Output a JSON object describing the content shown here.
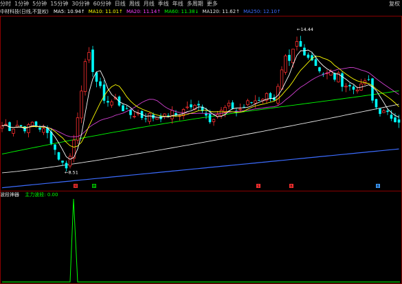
{
  "toolbar": {
    "items": [
      "分时",
      "1分钟",
      "5分钟",
      "15分钟",
      "30分钟",
      "60分钟",
      "日线",
      "周线",
      "月线",
      "季线",
      "年线",
      "多周期",
      "更多"
    ],
    "right_label": "复权"
  },
  "main_legend": {
    "title": "中材科技(日线,不复权)",
    "ma": [
      {
        "text": "MA5: 10.94↑",
        "color": "#ffffff"
      },
      {
        "text": "MA10: 11.01↑",
        "color": "#ffff00"
      },
      {
        "text": "MA20: 11.14↑",
        "color": "#ff40ff"
      },
      {
        "text": "MA60: 11.38↓",
        "color": "#00ff00"
      },
      {
        "text": "MA120: 11.62↑",
        "color": "#e0e0e0"
      },
      {
        "text": "MA250: 12.10↑",
        "color": "#3c6cff"
      }
    ]
  },
  "annotations": {
    "high": "14.44",
    "low": "8.51"
  },
  "signals": [
    {
      "label": "买",
      "color": "#ff3030"
    },
    {
      "label": "卖",
      "color": "#00c000"
    },
    {
      "label": "S",
      "color": "#ff3030"
    },
    {
      "label": "B",
      "color": "#ff3030"
    },
    {
      "label": "B",
      "color": "#3c9cff"
    }
  ],
  "indicator": {
    "name": "波段神器",
    "line_label": "主力波段: 0.00",
    "line_color": "#00ff00"
  },
  "colors": {
    "up": "#ff3030",
    "down": "#00ffff",
    "background": "#000000",
    "frame": "#8b0000"
  }
}
